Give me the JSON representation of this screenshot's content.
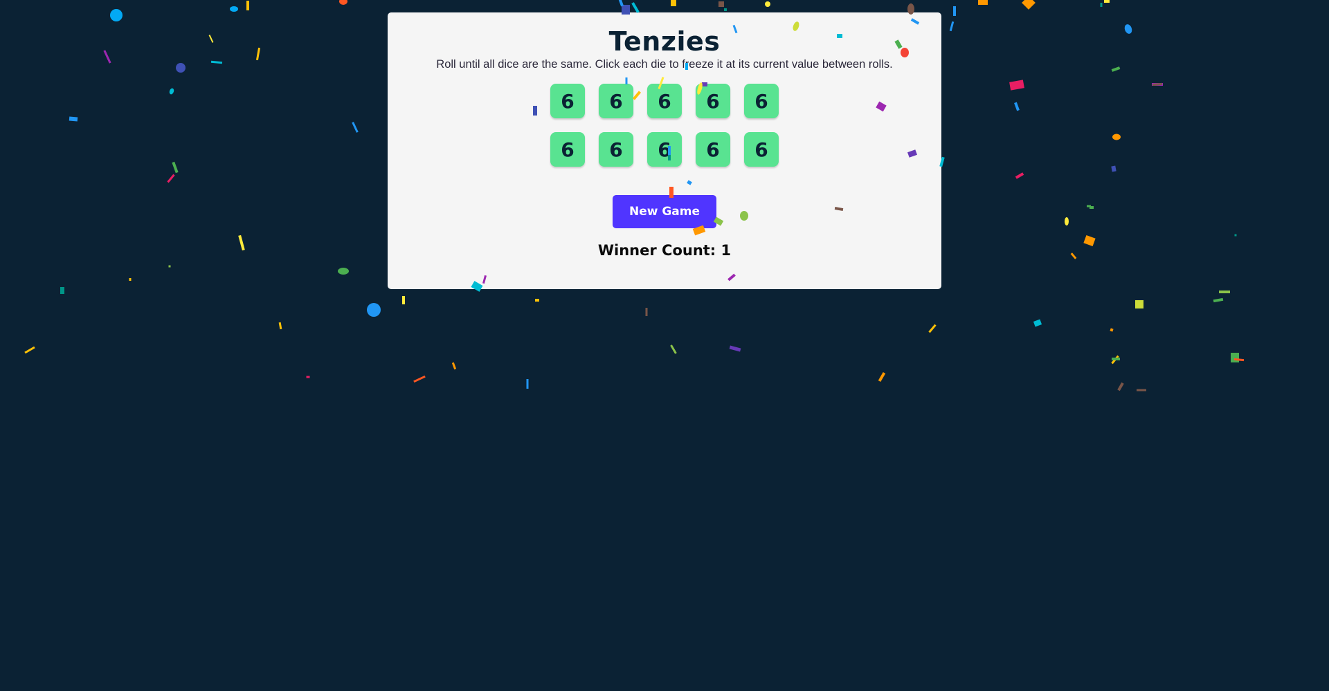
{
  "game": {
    "title": "Tenzies",
    "instructions": "Roll until all dice are the same. Click each die to freeze it at its current value between rolls.",
    "dice": [
      {
        "value": "6",
        "held": false
      },
      {
        "value": "6",
        "held": false
      },
      {
        "value": "6",
        "held": false
      },
      {
        "value": "6",
        "held": false
      },
      {
        "value": "6",
        "held": false
      },
      {
        "value": "6",
        "held": false
      },
      {
        "value": "6",
        "held": false
      },
      {
        "value": "6",
        "held": false
      },
      {
        "value": "6",
        "held": false
      },
      {
        "value": "6",
        "held": false
      }
    ],
    "button_label": "New Game",
    "winner_count": "Winner Count: 1",
    "won": true
  },
  "colors": {
    "background": "#0b2234",
    "card": "#f5f5f5",
    "die": "#59e391",
    "button": "#5035ff"
  },
  "confetti_palette": [
    "#f44336",
    "#e91e63",
    "#9c27b0",
    "#673ab7",
    "#3f51b5",
    "#2196f3",
    "#03a9f4",
    "#00bcd4",
    "#009688",
    "#4caf50",
    "#8bc34a",
    "#cddc39",
    "#ffeb3b",
    "#ffc107",
    "#ff9800",
    "#ff5722",
    "#795548"
  ]
}
